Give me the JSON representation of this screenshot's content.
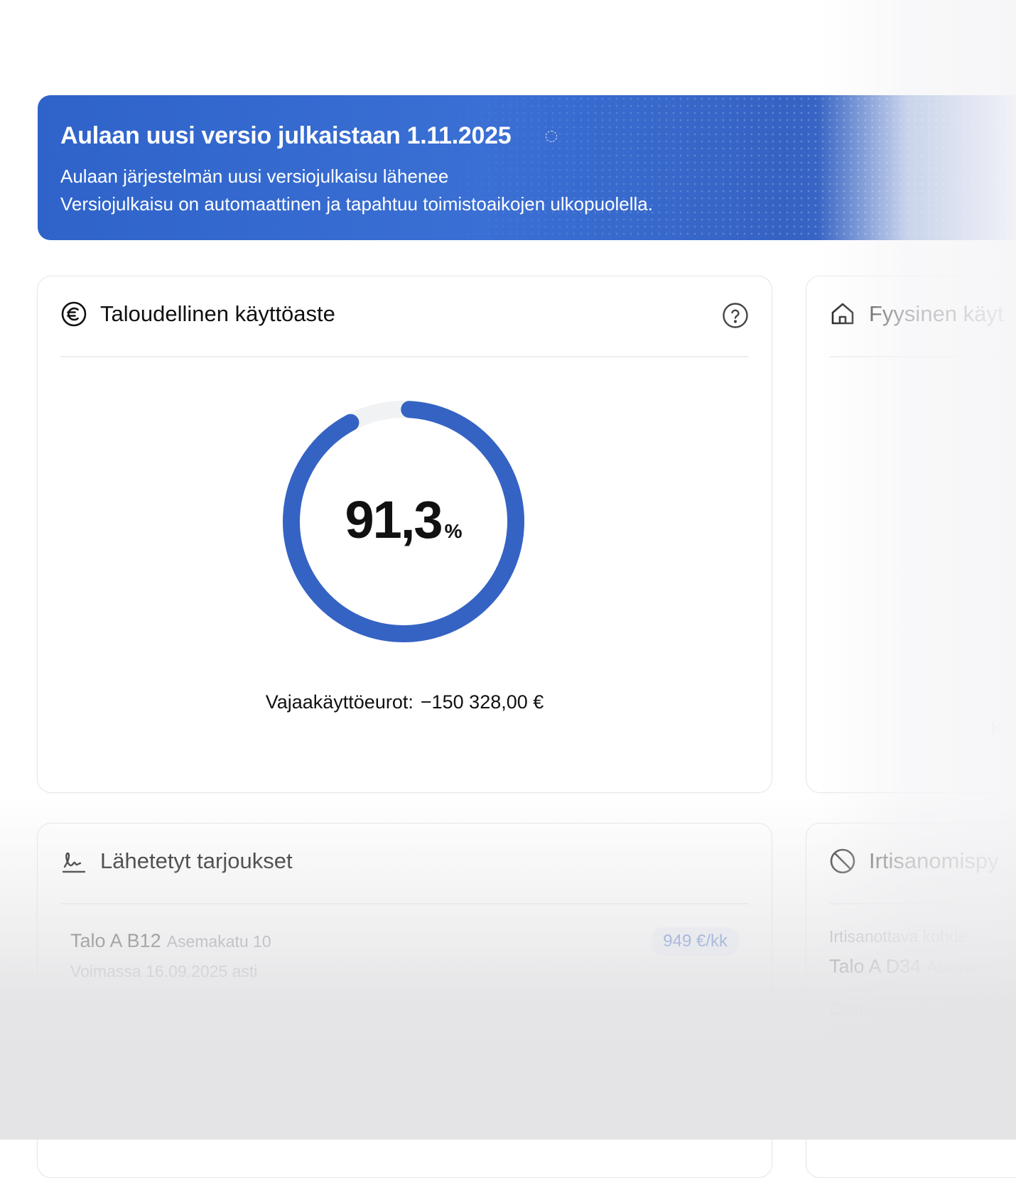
{
  "banner": {
    "title": "Aulaan uusi versio julkaistaan 1.11.2025",
    "line1": "Aulaan järjestelmän uusi versiojulkaisu lähenee",
    "line2": "Versiojulkaisu on automaattinen ja tapahtuu toimistoaikojen ulkopuolella."
  },
  "economic_card": {
    "icon": "euro-circle-icon",
    "title": "Taloudellinen käyttöaste",
    "help_icon": "help-circle-icon",
    "gauge": {
      "value_label": "91,3",
      "unit": "%",
      "fraction": 0.913
    },
    "underuse_label": "Vajaakäyttöeurot:",
    "underuse_value": "−150 328,00 €"
  },
  "physical_card": {
    "icon": "house-icon",
    "title": "Fyysinen käyt",
    "cut_text": "K"
  },
  "offers_card": {
    "icon": "signature-icon",
    "title": "Lähetetyt tarjoukset",
    "rows": [
      {
        "name": "Talo A B12",
        "address": "Asemakatu 10",
        "valid": "Voimassa 16.09.2025 asti",
        "price": "949 €/kk"
      }
    ]
  },
  "termination_card": {
    "icon": "ban-icon",
    "title": "Irtisanomispy",
    "target_label": "Irtisanottava kohde",
    "target_name": "Talo A D34",
    "target_address": "Asema",
    "party": "Osapuoli 1"
  },
  "colors": {
    "accent": "#3563c4",
    "banner": "#3a6fd4",
    "gauge_track": "#f1f2f4"
  }
}
